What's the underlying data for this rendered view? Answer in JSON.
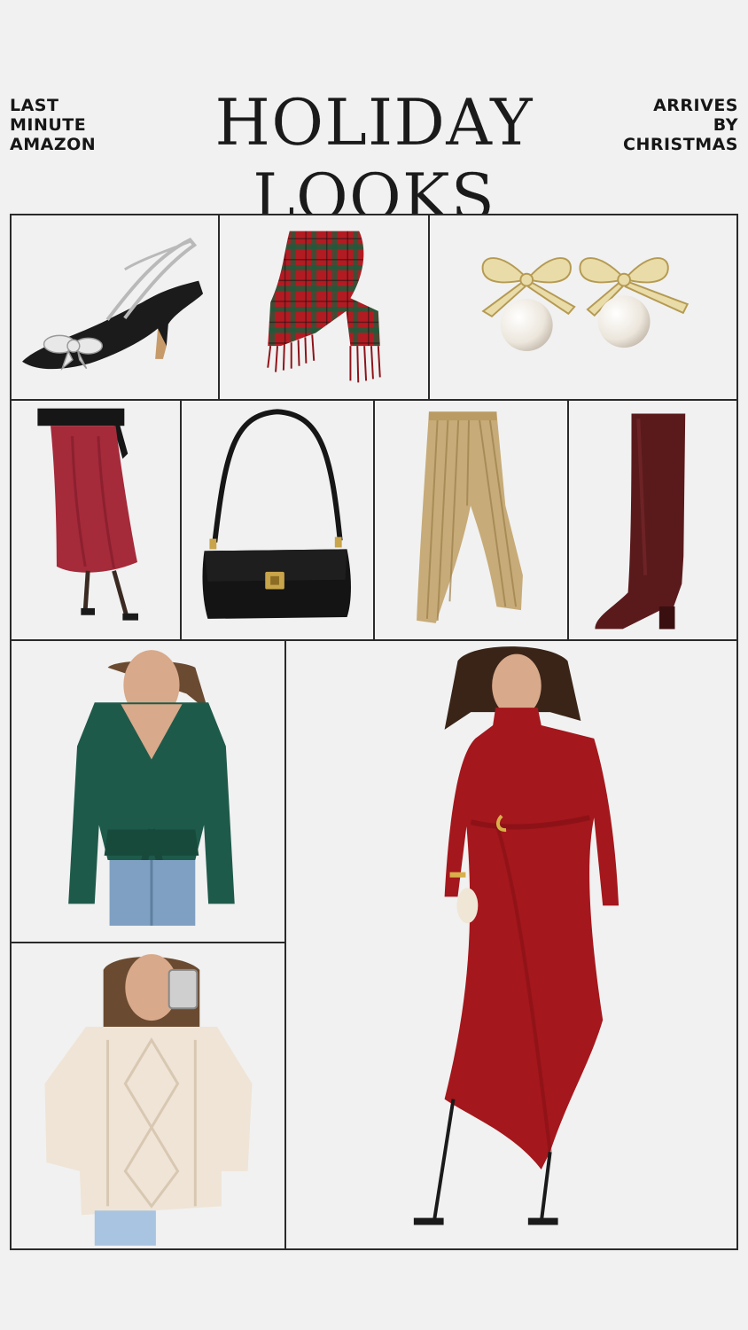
{
  "header": {
    "left_lines": [
      "LAST",
      "MINUTE",
      "AMAZON"
    ],
    "title": "HOLIDAY LOOKS",
    "right_lines": [
      "ARRIVES",
      "BY",
      "CHRISTMAS"
    ]
  },
  "products": [
    {
      "name": "bow-heel-pump",
      "icon": "shoe-icon",
      "color": "#1b1b1b"
    },
    {
      "name": "plaid-scarf",
      "icon": "scarf-icon",
      "color": "#b31b22"
    },
    {
      "name": "pearl-bow-earrings",
      "icon": "earring-icon",
      "color": "#d9c27a"
    },
    {
      "name": "satin-midi-skirt",
      "icon": "skirt-icon",
      "color": "#a52a3a"
    },
    {
      "name": "black-shoulder-bag",
      "icon": "handbag-icon",
      "color": "#111111"
    },
    {
      "name": "gold-pleated-pants",
      "icon": "pants-icon",
      "color": "#c7ab78"
    },
    {
      "name": "burgundy-knee-boot",
      "icon": "boot-icon",
      "color": "#5a1a1c"
    },
    {
      "name": "green-wrap-sweater",
      "icon": "sweater-icon",
      "color": "#1e5a4a"
    },
    {
      "name": "red-twist-maxi-dress",
      "icon": "dress-icon",
      "color": "#a4171c"
    },
    {
      "name": "cream-cable-knit-sweater",
      "icon": "sweater-icon",
      "color": "#efe4d6"
    }
  ]
}
